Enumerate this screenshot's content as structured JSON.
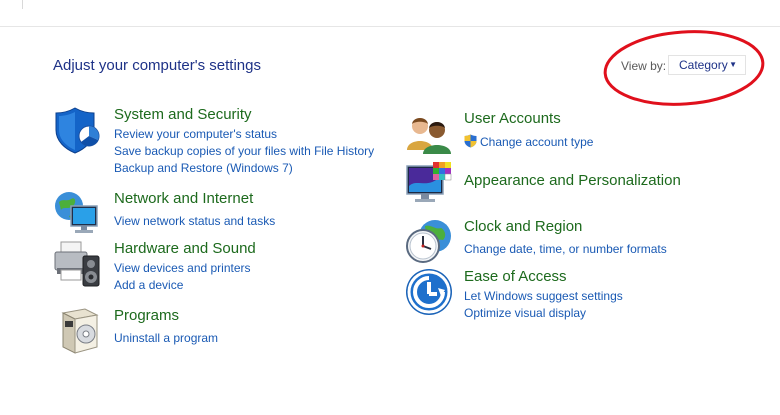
{
  "header": {
    "title": "Adjust your computer's settings",
    "view_by_label": "View by:",
    "view_by_value": "Category"
  },
  "categories": [
    {
      "title": "System and Security",
      "links": [
        "Review your computer's status",
        "Save backup copies of your files with File History",
        "Backup and Restore (Windows 7)"
      ]
    },
    {
      "title": "Network and Internet",
      "links": [
        "View network status and tasks"
      ]
    },
    {
      "title": "Hardware and Sound",
      "links": [
        "View devices and printers",
        "Add a device"
      ]
    },
    {
      "title": "Programs",
      "links": [
        "Uninstall a program"
      ]
    },
    {
      "title": "User Accounts",
      "links": [
        "Change account type"
      ]
    },
    {
      "title": "Appearance and Personalization",
      "links": []
    },
    {
      "title": "Clock and Region",
      "links": [
        "Change date, time, or number formats"
      ]
    },
    {
      "title": "Ease of Access",
      "links": [
        "Let Windows suggest settings",
        "Optimize visual display"
      ]
    }
  ],
  "icons": {
    "system": "shield-icon",
    "network": "globe-monitor-icon",
    "hardware": "printer-speaker-icon",
    "programs": "software-box-icon",
    "users": "users-icon",
    "appearance": "monitor-palette-icon",
    "clock": "clock-globe-icon",
    "ease": "ease-of-access-icon",
    "uac": "uac-shield-icon"
  },
  "colors": {
    "title": "#1e3287",
    "category_title": "#1d6a1d",
    "link": "#1a5ab4",
    "annotation": "#e0101c"
  }
}
